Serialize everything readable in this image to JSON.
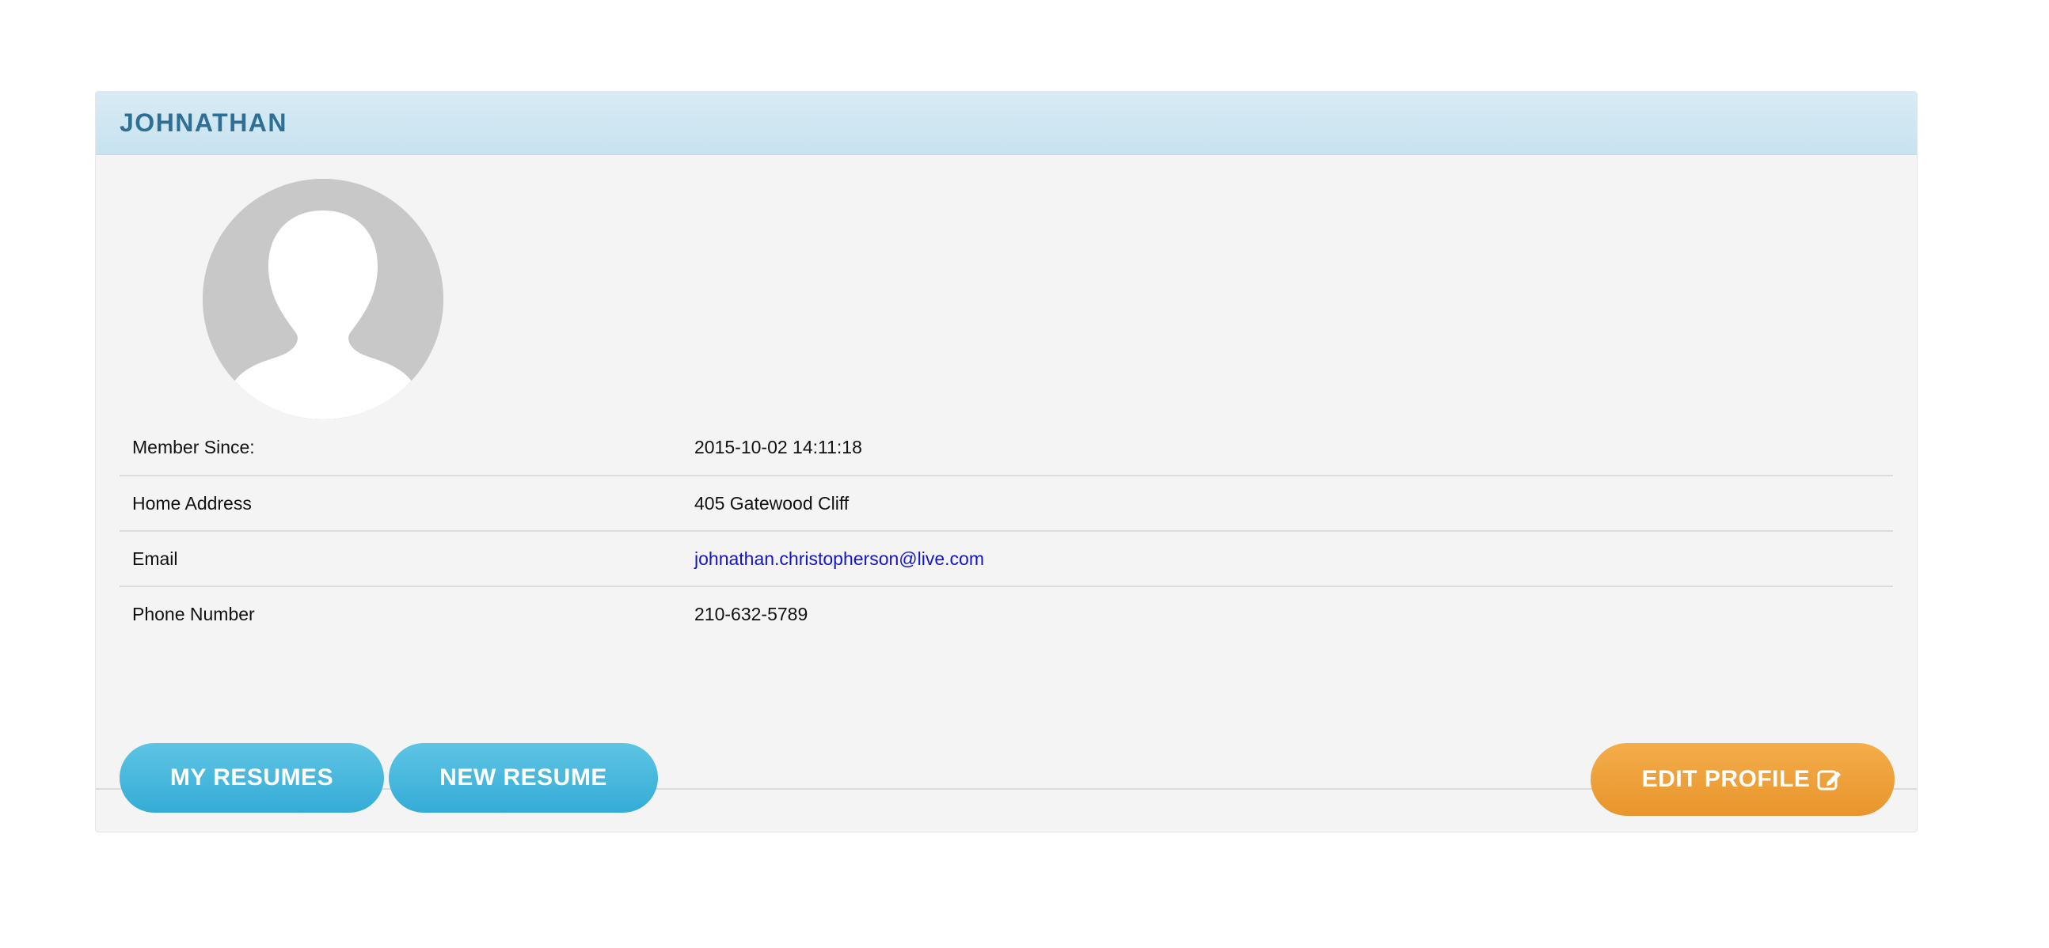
{
  "profile": {
    "name": "JOHNATHAN"
  },
  "details": [
    {
      "label": "Member Since:",
      "value": "2015-10-02 14:11:18"
    },
    {
      "label": "Home Address",
      "value": "405 Gatewood Cliff"
    },
    {
      "label": "Email",
      "value": "johnathan.christopherson@live.com"
    },
    {
      "label": "Phone Number",
      "value": "210-632-5789"
    }
  ],
  "actions": {
    "my_resumes": "MY RESUMES",
    "new_resume": "NEW RESUME",
    "edit_profile": "EDIT PROFILE"
  },
  "icons": {
    "avatar": "default-user-avatar",
    "edit": "edit-square-icon"
  },
  "colors": {
    "header_bg": "#c9e4f1",
    "header_text": "#2f6f93",
    "button_blue": "#3fb4dc",
    "button_orange": "#eea13b",
    "link": "#1515c8"
  }
}
